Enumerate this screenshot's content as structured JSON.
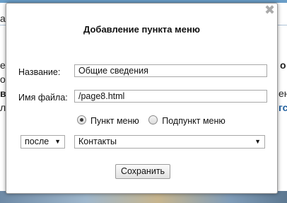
{
  "dialog": {
    "title": "Добавление пункта меню",
    "name_label": "Название:",
    "name_value": "Общие сведения",
    "file_label": "Имя файла:",
    "file_value": "/page8.html",
    "radio_item": "Пункт меню",
    "radio_subitem": "Подпункт меню",
    "position_value": "после",
    "target_value": "Контакты",
    "save_label": "Сохранить"
  },
  "background": {
    "left_fragments": [
      "а",
      "е",
      "оя",
      "в",
      "л"
    ],
    "right_fragments": [
      "о",
      "ен",
      "гс"
    ]
  }
}
